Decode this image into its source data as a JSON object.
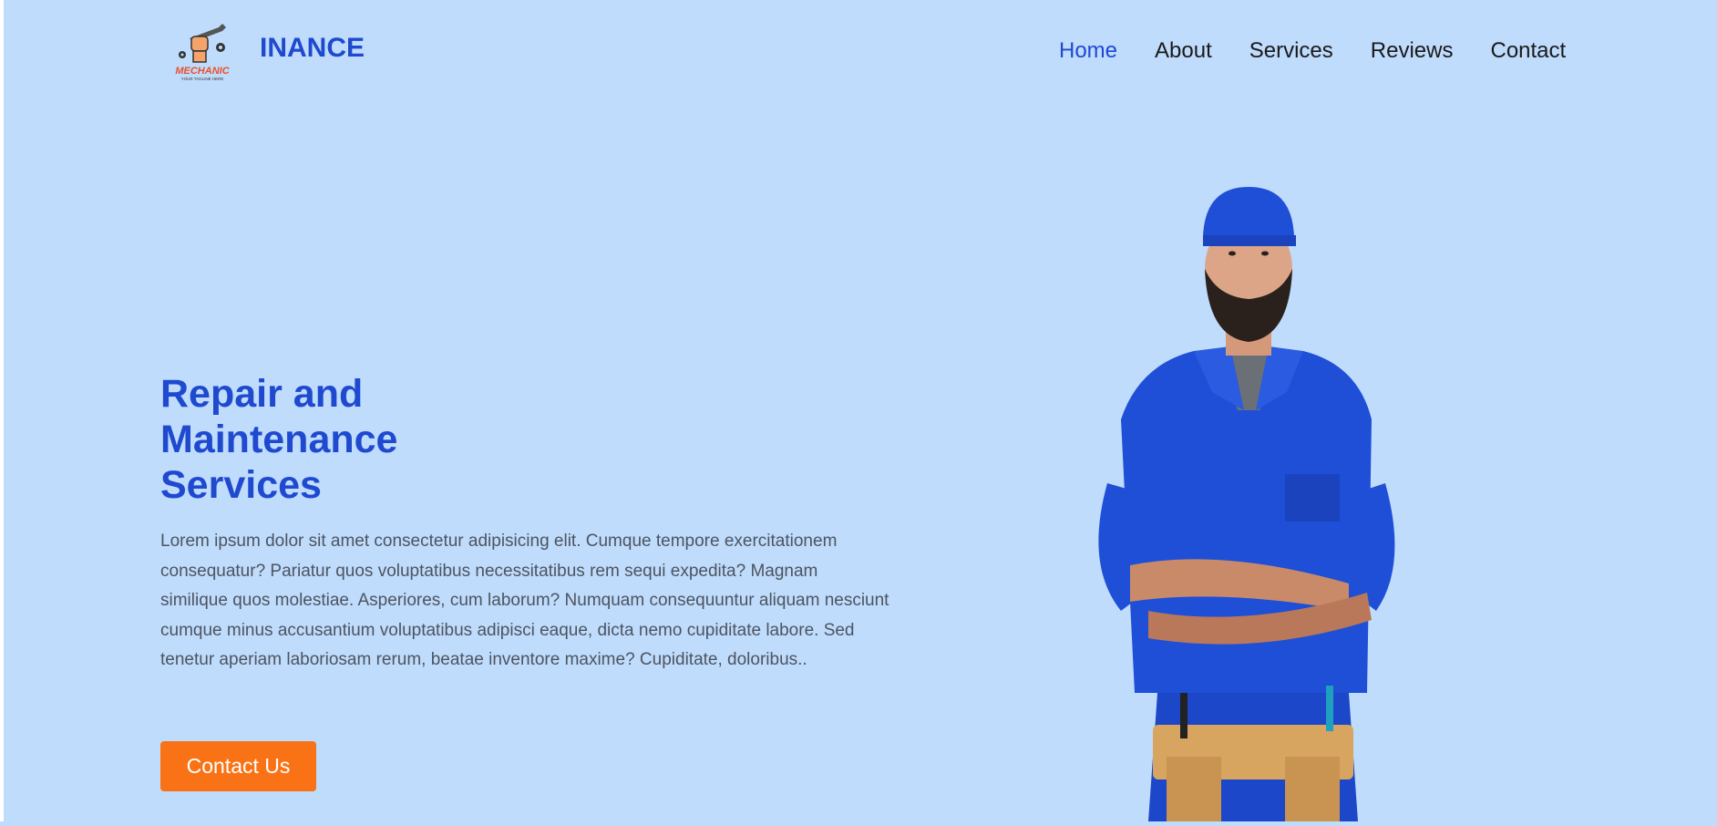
{
  "header": {
    "logo_text": "MECHANIC",
    "logo_tagline": "YOUR TAGLINE HERE",
    "brand": "INANCE"
  },
  "nav": {
    "items": [
      "Home",
      "About",
      "Services",
      "Reviews",
      "Contact"
    ],
    "active": "Home"
  },
  "hero": {
    "title_lines": [
      "Repair and",
      "Maintenance",
      "Services"
    ],
    "description": "Lorem ipsum dolor sit amet consectetur adipisicing elit. Cumque tempore exercitationem consequatur? Pariatur quos voluptatibus necessitatibus rem sequi expedita? Magnam similique quos molestiae. Asperiores, cum laborum? Numquam consequuntur aliquam nesciunt cumque minus accusantium voluptatibus adipisci eaque, dicta nemo cupiditate labore. Sed tenetur aperiam laboriosam rerum, beatae inventore maxime? Cupiditate, doloribus..",
    "cta_label": "Contact Us",
    "image": "mechanic-worker-photo"
  },
  "colors": {
    "background": "#bfdcfc",
    "brand": "#1f49cf",
    "accent": "#f97316",
    "body_text": "#4d5460",
    "nav_text": "#1a1a1a"
  }
}
